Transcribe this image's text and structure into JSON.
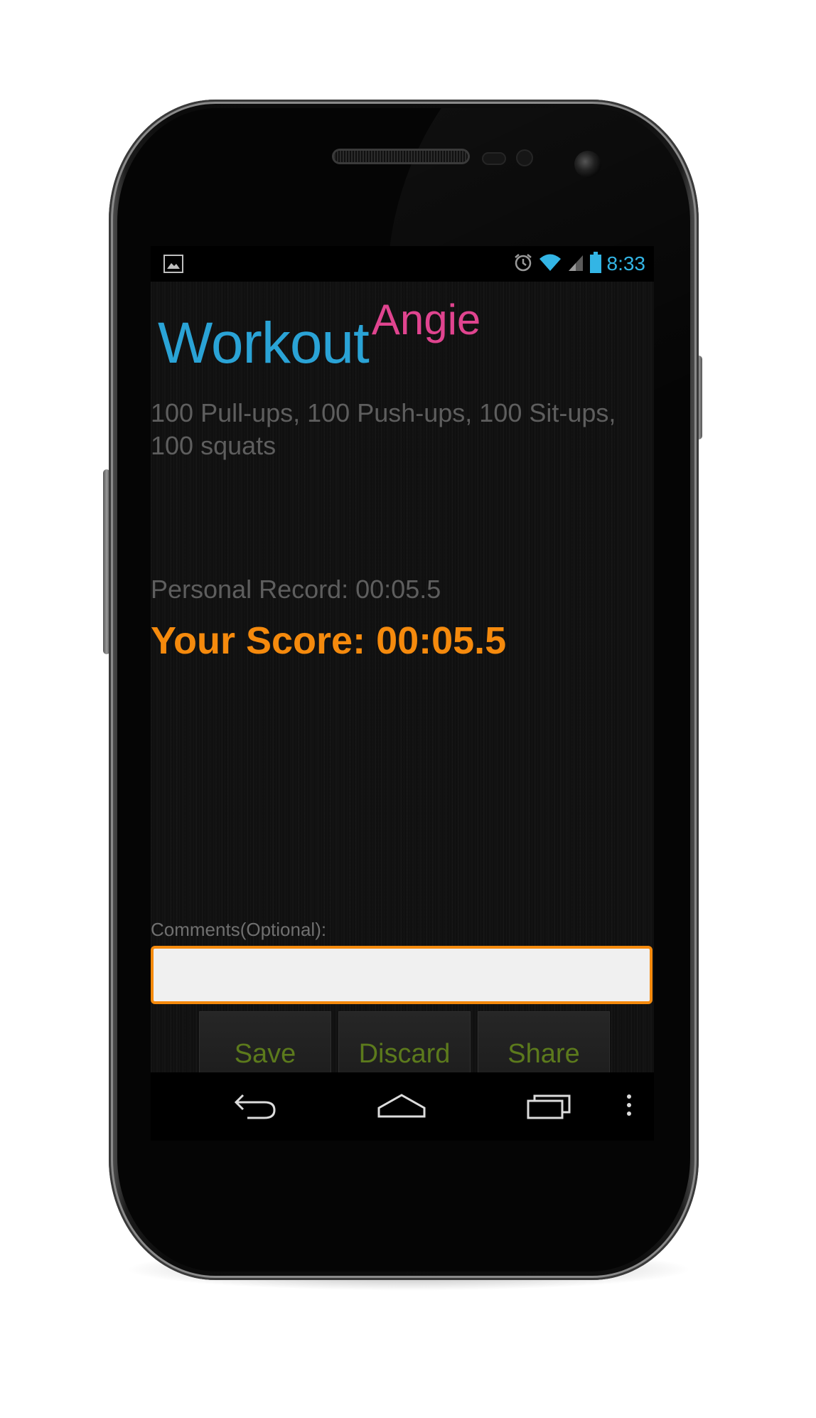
{
  "status_bar": {
    "time": "8:33",
    "icons": [
      "image-notification-icon",
      "alarm-icon",
      "wifi-icon",
      "signal-icon",
      "battery-icon"
    ]
  },
  "app": {
    "title_main": "Workout",
    "title_sub": "Angie",
    "workout_description": "100 Pull-ups, 100 Push-ups, 100 Sit-ups, 100 squats",
    "personal_record": "Personal Record: 00:05.5",
    "score": "Your Score: 00:05.5",
    "comments_label": "Comments(Optional):",
    "comments_value": "",
    "buttons": {
      "save": "Save",
      "discard": "Discard",
      "share": "Share"
    }
  },
  "navigation_bar": {
    "icons": [
      "back-icon",
      "home-icon",
      "recent-apps-icon",
      "overflow-menu-icon"
    ]
  },
  "colors": {
    "title_workout": "#2aa3d6",
    "title_angie": "#e0448f",
    "score": "#f58a0d",
    "button_text": "#5c7a1c",
    "status_time": "#33b5e5"
  }
}
